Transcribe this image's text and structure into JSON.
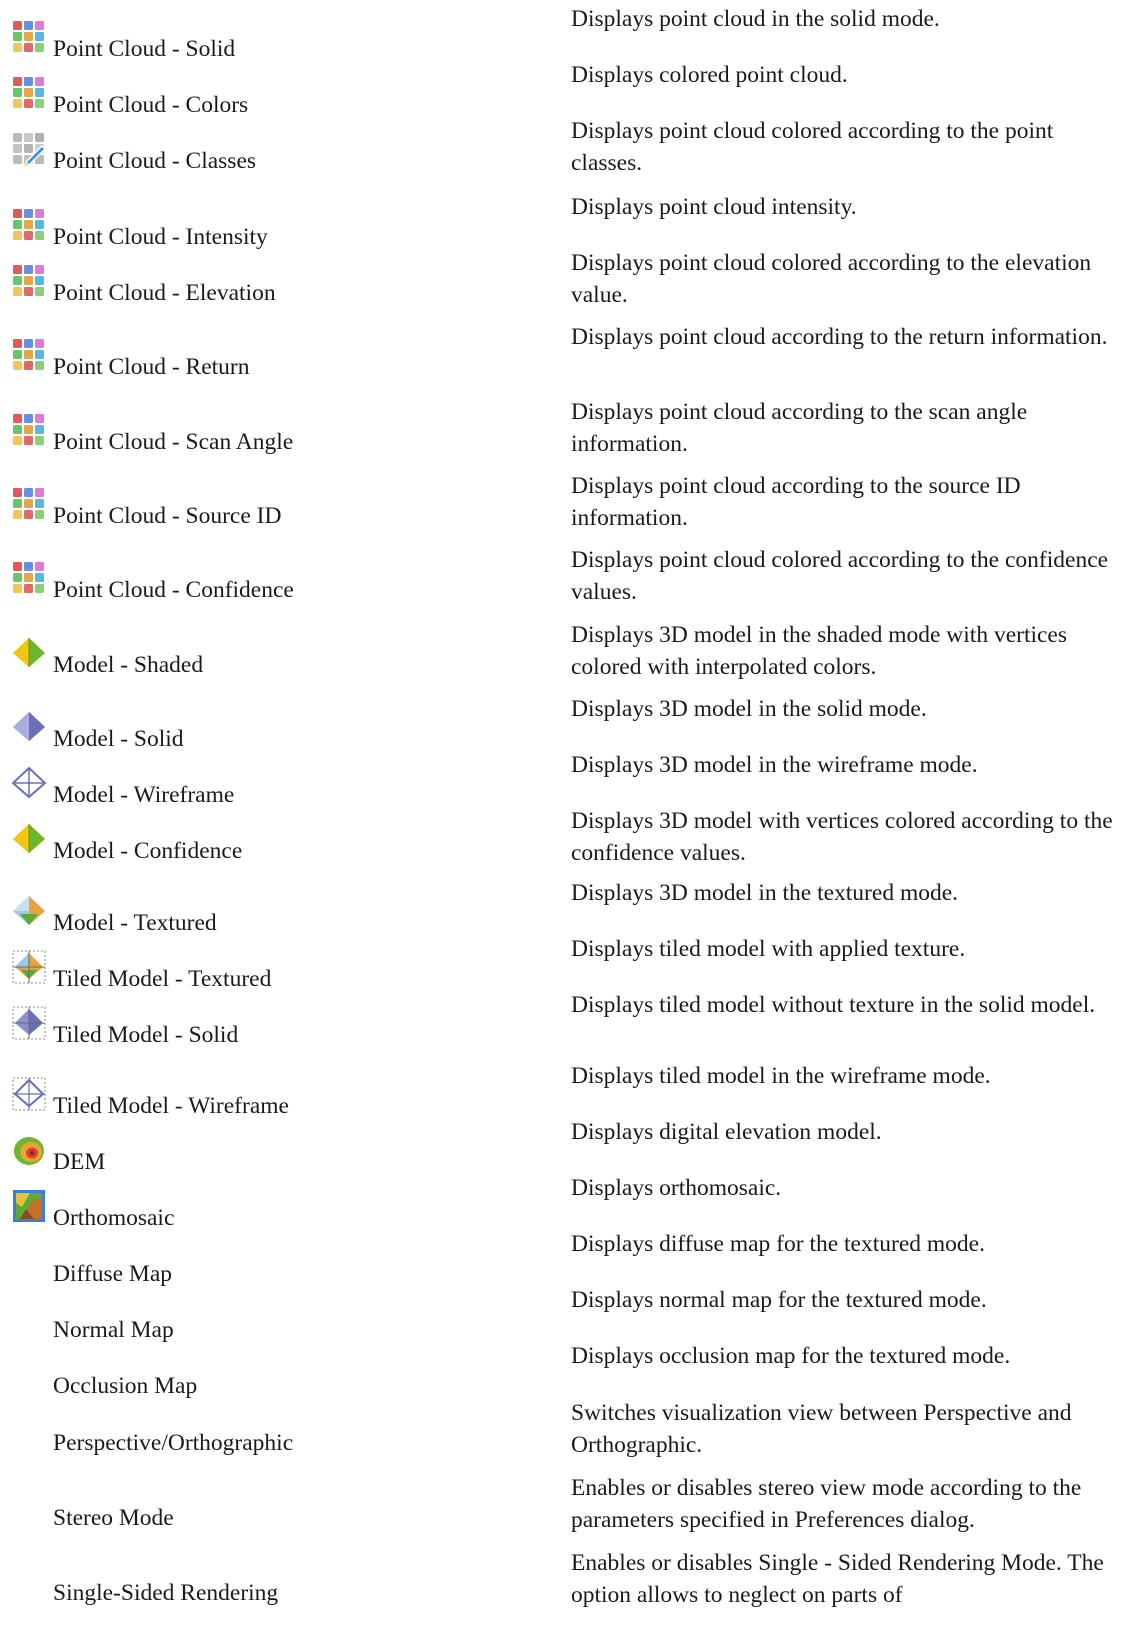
{
  "rows": [
    {
      "icon": "point-cloud-icon",
      "command": "Point Cloud - Solid",
      "description": "Displays point cloud in the solid mode."
    },
    {
      "icon": "point-cloud-icon",
      "command": "Point Cloud - Colors",
      "description": "Displays colored point cloud."
    },
    {
      "icon": "point-cloud-classes-icon",
      "command": "Point Cloud - Classes",
      "description": "Displays point cloud colored according to the point classes."
    },
    {
      "icon": "point-cloud-icon",
      "command": "Point Cloud - Intensity",
      "description": "Displays point cloud intensity."
    },
    {
      "icon": "point-cloud-icon",
      "command": "Point Cloud - Elevation",
      "description": "Displays point cloud colored according to the elevation value."
    },
    {
      "icon": "point-cloud-icon",
      "command": "Point Cloud - Return",
      "description": "Displays point cloud according to the return information."
    },
    {
      "icon": "point-cloud-icon",
      "command": "Point Cloud - Scan Angle",
      "description": "Displays point cloud according to the scan angle information."
    },
    {
      "icon": "point-cloud-icon",
      "command": "Point Cloud - Source ID",
      "description": "Displays point cloud according to the source ID information."
    },
    {
      "icon": "point-cloud-icon",
      "command": "Point Cloud - Confidence",
      "description": "Displays point cloud colored according to the confidence values."
    },
    {
      "icon": "model-shaded-icon",
      "command": "Model - Shaded",
      "description": "Displays 3D model in the shaded mode with vertices colored with interpolated colors."
    },
    {
      "icon": "model-solid-icon",
      "command": "Model - Solid",
      "description": "Displays 3D model in the solid mode."
    },
    {
      "icon": "model-wireframe-icon",
      "command": "Model - Wireframe",
      "description": "Displays 3D model in the wireframe mode."
    },
    {
      "icon": "model-confidence-icon",
      "command": "Model - Confidence",
      "description": "Displays 3D model with vertices colored according to the confidence values."
    },
    {
      "icon": "model-textured-icon",
      "command": "Model - Textured",
      "description": "Displays 3D model in the textured mode."
    },
    {
      "icon": "tiled-model-textured-icon",
      "command": "Tiled Model - Textured",
      "description": "Displays tiled model with applied texture."
    },
    {
      "icon": "tiled-model-solid-icon",
      "command": "Tiled Model - Solid",
      "description": "Displays tiled model without texture in the solid model."
    },
    {
      "icon": "tiled-model-wireframe-icon",
      "command": "Tiled Model - Wireframe",
      "description": "Displays tiled model in the wireframe mode."
    },
    {
      "icon": "dem-icon",
      "command": "DEM",
      "description": "Displays digital elevation model."
    },
    {
      "icon": "orthomosaic-icon",
      "command": "Orthomosaic",
      "description": "Displays orthomosaic."
    },
    {
      "icon": "",
      "command": "Diffuse Map",
      "description": "Displays diffuse map for the textured mode."
    },
    {
      "icon": "",
      "command": "Normal Map",
      "description": "Displays normal map for the textured mode."
    },
    {
      "icon": "",
      "command": "Occlusion Map",
      "description": "Displays occlusion map for the textured mode."
    },
    {
      "icon": "",
      "command": "Perspective/Orthographic",
      "description": "Switches visualization view between Perspective and Orthographic."
    },
    {
      "icon": "",
      "command": "Stereo Mode",
      "description": "Enables or disables stereo view mode according to the parameters specified in Preferences dialog."
    },
    {
      "icon": "",
      "command": "Single-Sided Rendering",
      "description": "Enables or disables Single - Sided Rendering Mode. The option allows to neglect on parts of"
    }
  ]
}
